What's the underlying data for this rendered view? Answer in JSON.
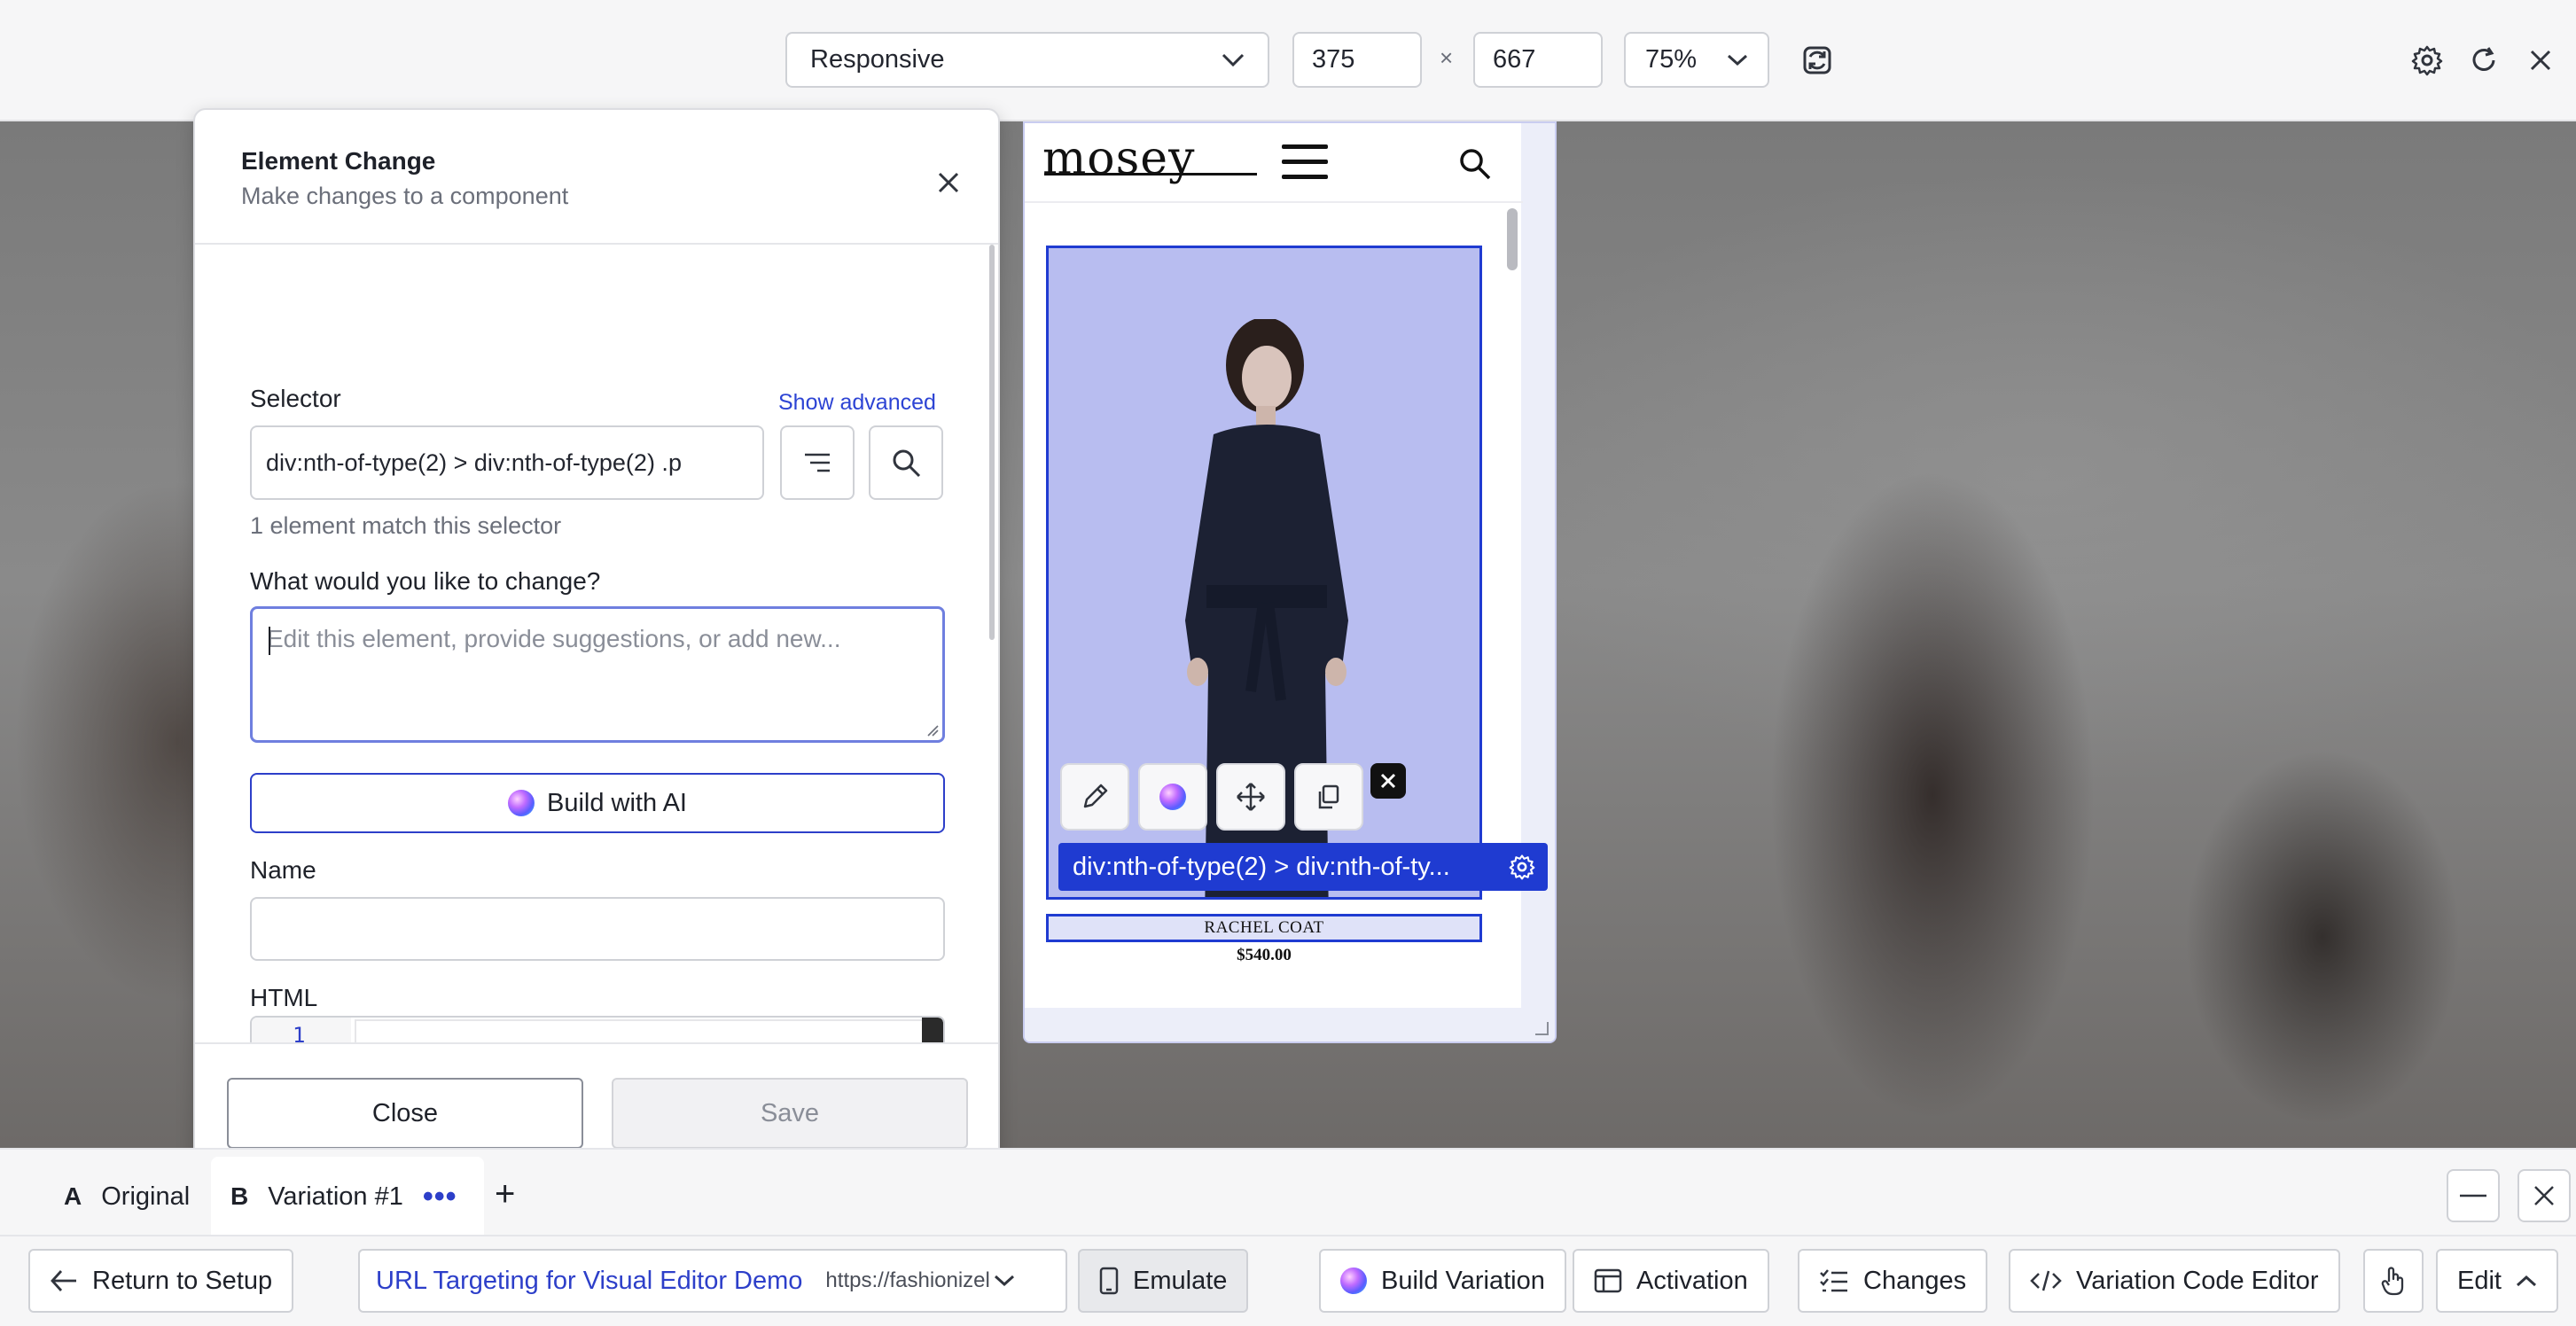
{
  "toolbar": {
    "device": "Responsive",
    "width": "375",
    "times": "×",
    "height": "667",
    "zoom": "75%"
  },
  "panel": {
    "title": "Element Change",
    "subtitle": "Make changes to a component",
    "selector_label": "Selector",
    "show_advanced": "Show advanced",
    "selector_value": "div:nth-of-type(2) > div:nth-of-type(2) .p",
    "match_hint": "1 element match this selector",
    "change_label": "What would you like to change?",
    "change_placeholder": "Edit this element, provide suggestions, or add new...",
    "build_ai": "Build with AI",
    "name_label": "Name",
    "html_label": "HTML",
    "line_number": "1",
    "close": "Close",
    "save": "Save"
  },
  "preview": {
    "logo": "mosey",
    "selection_label": "div:nth-of-type(2) > div:nth-of-ty...",
    "product_name": "RACHEL COAT",
    "product_price": "$540.00"
  },
  "tabs": {
    "original_letter": "A",
    "original": "Original",
    "variation_letter": "B",
    "variation": "Variation #1",
    "more": "•••",
    "add": "+"
  },
  "bottombar": {
    "return": "Return to Setup",
    "targeting_name": "URL Targeting for Visual Editor Demo",
    "targeting_url": "https://fashionizel",
    "emulate": "Emulate",
    "build_variation": "Build Variation",
    "activation": "Activation",
    "changes": "Changes",
    "code_editor": "Variation Code Editor",
    "edit": "Edit"
  },
  "colors": {
    "accent": "#1f3bd1",
    "link": "#2d44d4",
    "selection_fill": "#b8bdf0"
  }
}
